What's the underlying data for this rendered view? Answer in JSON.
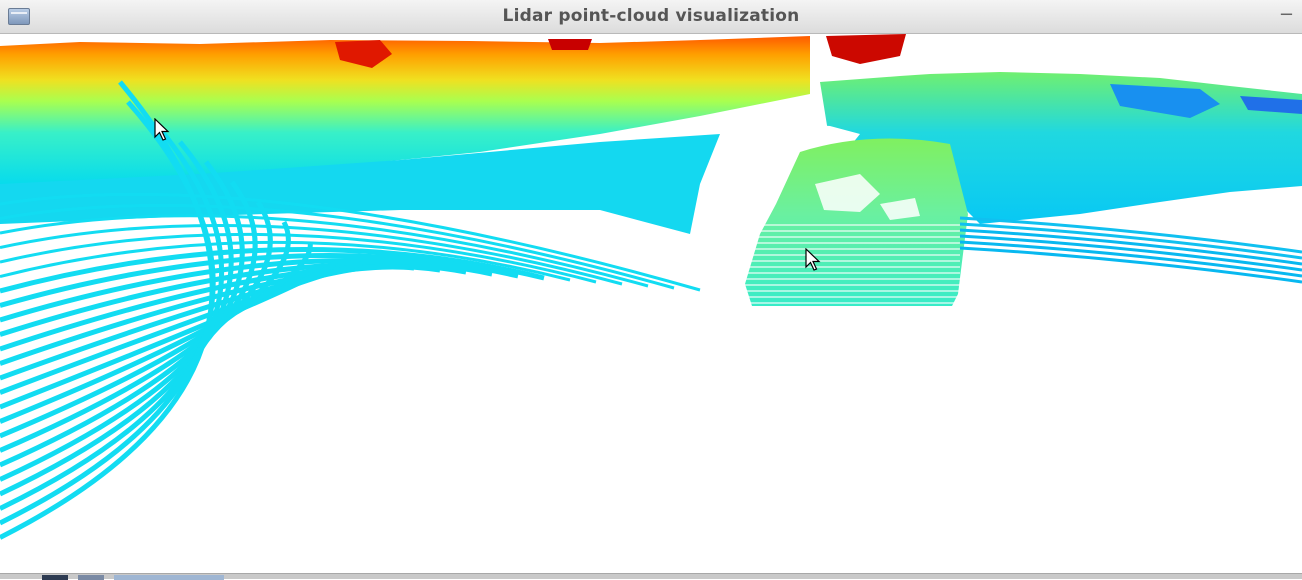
{
  "window": {
    "title": "Lidar point-cloud visualization",
    "menu_icon": "window-menu-icon",
    "minimize_glyph": "−"
  },
  "viewport": {
    "background": "#ffffff",
    "colormap": "jet",
    "colormap_stops": [
      "#00e5ff",
      "#1ad0f0",
      "#7fff60",
      "#ffd400",
      "#ff7a00",
      "#d40000"
    ],
    "ground_color": "#12dcf2",
    "car_color": "#6af0a8",
    "far_object_color": "#16a0f0"
  },
  "cursors": [
    {
      "name": "mouse-cursor-left",
      "icon": "arrow-pointer-icon"
    },
    {
      "name": "mouse-cursor-car",
      "icon": "arrow-pointer-icon"
    }
  ],
  "taskbar": {
    "icons": [
      "taskbar-app-icon",
      "taskbar-app-icon",
      "taskbar-window-button"
    ]
  }
}
